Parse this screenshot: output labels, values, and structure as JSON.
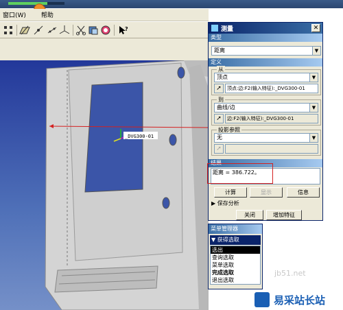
{
  "progress": 0.7,
  "menubar": {
    "items": [
      "窗口(W)",
      "帮助"
    ]
  },
  "model_label": "_DVG300-01",
  "dialog": {
    "title": "测量",
    "type_section": "类型",
    "type_value": "距离",
    "definition_section": "定义",
    "from_label": "从",
    "from_type": "顶点",
    "from_field": "顶点:边:F2(输入特征):_DVG300-01",
    "to_label": "到",
    "to_type": "曲线/边",
    "to_field": "边:F2(输入特征):_DVG300-01",
    "projection_label": "投影参照",
    "projection_value": "无",
    "result_section": "结果",
    "result_text": "距离 = 386.722。",
    "calc_button": "计算",
    "display_button": "显示",
    "info_button": "信息",
    "save_analysis": "保存分析",
    "close_button": "关闭",
    "add_feature_button": "增加特征"
  },
  "menu_manager": {
    "title": "菜单管理器",
    "subtitle": "获得选取",
    "items": [
      "选出",
      "查询选取",
      "菜单选取",
      "完成选取",
      "退出选取"
    ]
  },
  "watermark": {
    "text": "易采站长站",
    "faint": "jb51.net"
  },
  "colors": {
    "title_blue": "#0a246a",
    "viewport_blue": "#3a54a8",
    "arrow_red": "#d42020"
  }
}
